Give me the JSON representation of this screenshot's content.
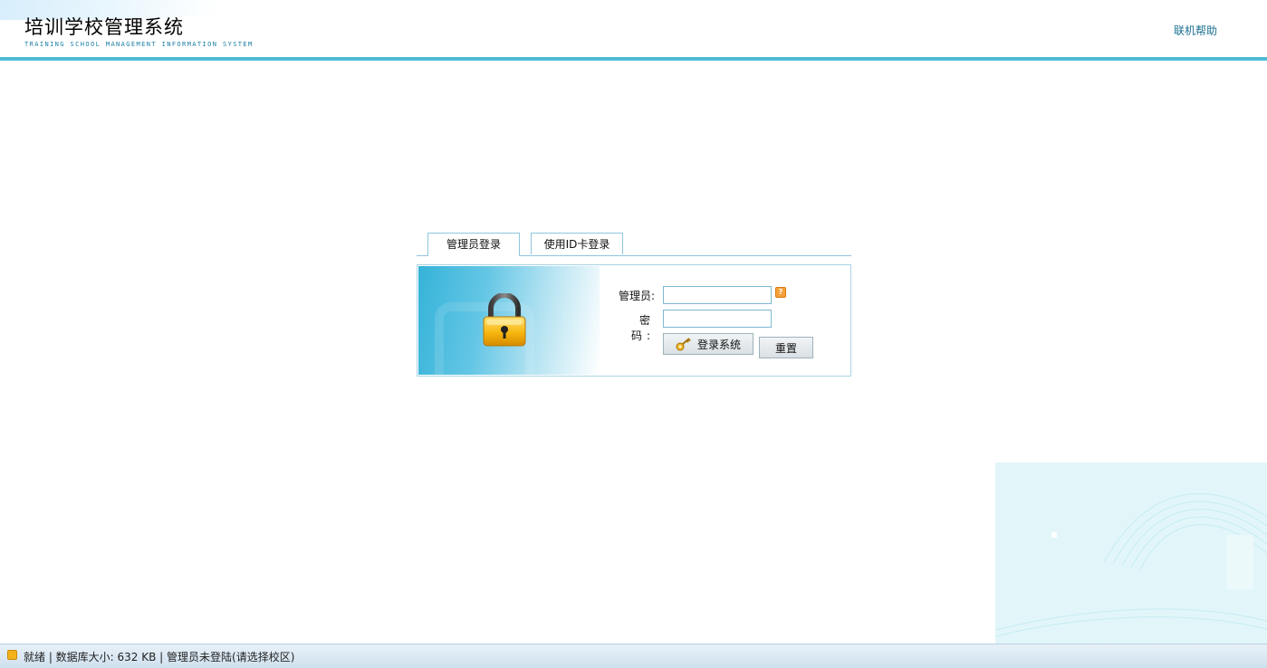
{
  "header": {
    "title": "培训学校管理系统",
    "subtitle": "TRAINING SCHOOL MANAGEMENT INFORMATION SYSTEM",
    "help_link": "联机帮助"
  },
  "tabs": [
    {
      "label": "管理员登录",
      "active": true
    },
    {
      "label": "使用ID卡登录",
      "active": false
    }
  ],
  "login": {
    "admin_label": "管理员:",
    "password_label": "密  码:",
    "admin_value": "",
    "password_value": "",
    "login_button": "登录系统",
    "reset_button": "重置"
  },
  "status_bar": {
    "text": "就绪 | 数据库大小: 632 KB | 管理员未登陆(请选择校区)"
  },
  "colors": {
    "accent": "#4dbbd5",
    "link": "#1a6f90",
    "panel_border": "#a9d4e6"
  },
  "icons": {
    "lock": "lock-icon",
    "key": "key-icon",
    "hint": "hint-icon",
    "status": "status-indicator-icon"
  }
}
